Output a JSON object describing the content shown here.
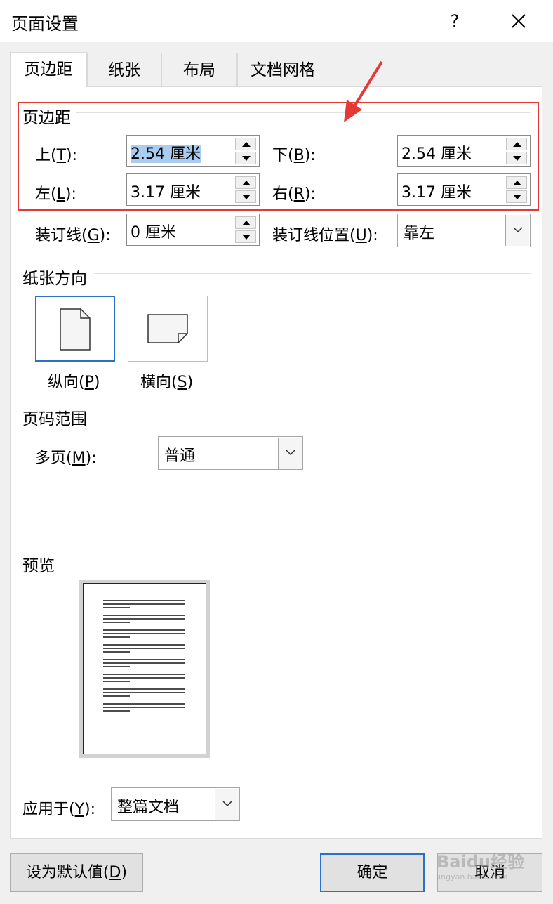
{
  "dialog": {
    "title": "页面设置",
    "help": "?"
  },
  "tabs": [
    {
      "label": "页边距",
      "active": true
    },
    {
      "label": "纸张",
      "active": false
    },
    {
      "label": "布局",
      "active": false
    },
    {
      "label": "文档网格",
      "active": false
    }
  ],
  "margins": {
    "group_label": "页边距",
    "top": {
      "label_pre": "上(",
      "key": "T",
      "label_post": "):",
      "value": "2.54 厘米"
    },
    "bottom": {
      "label_pre": "下(",
      "key": "B",
      "label_post": "):",
      "value": "2.54 厘米"
    },
    "left": {
      "label_pre": "左(",
      "key": "L",
      "label_post": "):",
      "value": "3.17 厘米"
    },
    "right": {
      "label_pre": "右(",
      "key": "R",
      "label_post": "):",
      "value": "3.17 厘米"
    },
    "gutter": {
      "label_pre": "装订线(",
      "key": "G",
      "label_post": "):",
      "value": "0 厘米"
    },
    "gutter_pos": {
      "label_pre": "装订线位置(",
      "key": "U",
      "label_post": "):",
      "value": "靠左"
    }
  },
  "orientation": {
    "group_label": "纸张方向",
    "portrait": {
      "label_pre": "纵向(",
      "key": "P",
      "label_post": ")",
      "selected": true
    },
    "landscape": {
      "label_pre": "横向(",
      "key": "S",
      "label_post": ")",
      "selected": false
    }
  },
  "pages": {
    "group_label": "页码范围",
    "multi": {
      "label_pre": "多页(",
      "key": "M",
      "label_post": "):",
      "value": "普通"
    }
  },
  "preview": {
    "group_label": "预览"
  },
  "apply_to": {
    "label_pre": "应用于(",
    "key": "Y",
    "label_post": "):",
    "value": "整篇文档"
  },
  "buttons": {
    "default": {
      "label_pre": "设为默认值(",
      "key": "D",
      "label_post": ")"
    },
    "ok": "确定",
    "cancel": "取消"
  },
  "colors": {
    "accent": "#2a72c8",
    "highlight": "#e53935",
    "selection": "#a8cdf0"
  },
  "watermark": {
    "text": "Baidu经验",
    "subtext": "jingyan.baidu.com"
  }
}
